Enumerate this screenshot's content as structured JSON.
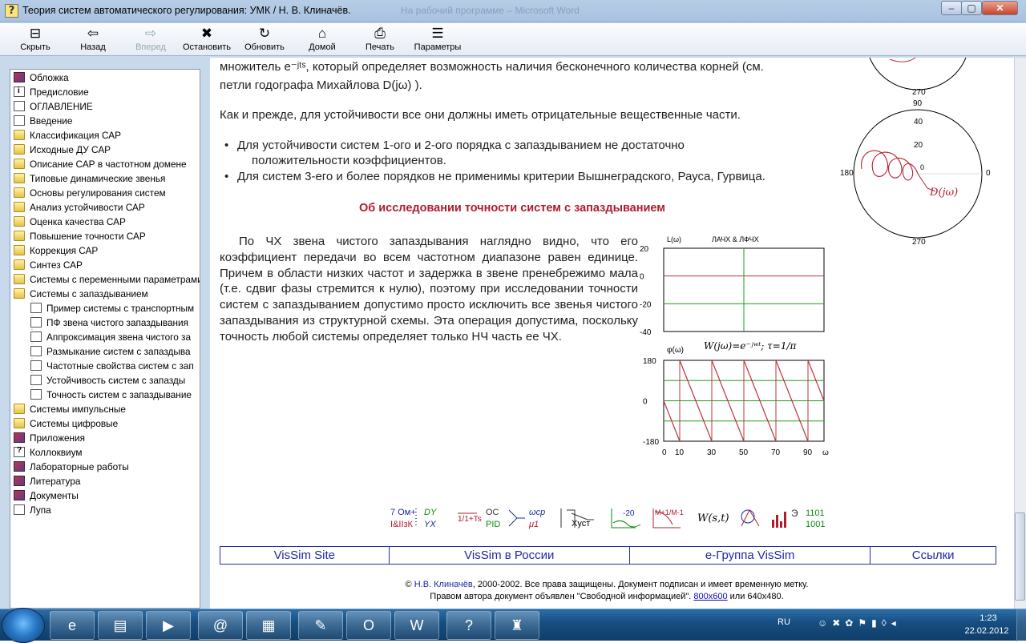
{
  "window": {
    "title": "Теория систем автоматического регулирования: УМК / Н. В. Клиначёв.",
    "background_title": "На рабочий программе – Microsoft Word",
    "controls": {
      "minimize": "–",
      "maximize": "▢",
      "close": "✕"
    }
  },
  "toolbar": [
    {
      "label": "Скрыть",
      "icon": "hide-pane-icon",
      "glyph": "⊟",
      "enabled": true
    },
    {
      "label": "Назад",
      "icon": "back-arrow-icon",
      "glyph": "⇦",
      "enabled": true
    },
    {
      "label": "Вперед",
      "icon": "forward-arrow-icon",
      "glyph": "⇨",
      "enabled": false
    },
    {
      "label": "Остановить",
      "icon": "stop-icon",
      "glyph": "✖",
      "enabled": true
    },
    {
      "label": "Обновить",
      "icon": "refresh-icon",
      "glyph": "↻",
      "enabled": true
    },
    {
      "label": "Домой",
      "icon": "home-icon",
      "glyph": "⌂",
      "enabled": true
    },
    {
      "label": "Печать",
      "icon": "print-icon",
      "glyph": "⎙",
      "enabled": true
    },
    {
      "label": "Параметры",
      "icon": "options-icon",
      "glyph": "☰",
      "enabled": true
    }
  ],
  "tree": [
    {
      "label": "Обложка",
      "icon": "book",
      "level": 0
    },
    {
      "label": "Предисловие",
      "icon": "page-i",
      "level": 0
    },
    {
      "label": "ОГЛАВЛЕНИЕ",
      "icon": "page",
      "level": 0
    },
    {
      "label": "Введение",
      "icon": "page",
      "level": 0
    },
    {
      "label": "Классификация САР",
      "icon": "folder",
      "level": 0
    },
    {
      "label": "Исходные ДУ САР",
      "icon": "folder",
      "level": 0
    },
    {
      "label": "Описание САР в частотном домене",
      "icon": "folder",
      "level": 0
    },
    {
      "label": "Типовые динамические звенья",
      "icon": "folder",
      "level": 0
    },
    {
      "label": "Основы регулирования систем",
      "icon": "folder",
      "level": 0
    },
    {
      "label": "Анализ устойчивости САР",
      "icon": "folder",
      "level": 0
    },
    {
      "label": "Оценка качества САР",
      "icon": "folder",
      "level": 0
    },
    {
      "label": "Повышение точности САР",
      "icon": "folder",
      "level": 0
    },
    {
      "label": "Коррекция САР",
      "icon": "folder",
      "level": 0
    },
    {
      "label": "Синтез САР",
      "icon": "folder",
      "level": 0
    },
    {
      "label": "Системы с переменными параметрами",
      "icon": "folder",
      "level": 0
    },
    {
      "label": "Системы с запаздыванием",
      "icon": "folder-open",
      "level": 0
    },
    {
      "label": "Пример системы с транспортным",
      "icon": "page",
      "level": 1
    },
    {
      "label": "ПФ звена чистого запаздывания",
      "icon": "page",
      "level": 1
    },
    {
      "label": "Аппроксимация звена чистого за",
      "icon": "page",
      "level": 1
    },
    {
      "label": "Размыкание систем с запаздыва",
      "icon": "page",
      "level": 1
    },
    {
      "label": "Частотные свойства систем с зап",
      "icon": "page",
      "level": 1
    },
    {
      "label": "Устойчивость систем с запазды",
      "icon": "page",
      "level": 1
    },
    {
      "label": "Точность систем с запаздывание",
      "icon": "page",
      "level": 1
    },
    {
      "label": "Системы импульсные",
      "icon": "folder",
      "level": 0
    },
    {
      "label": "Системы цифровые",
      "icon": "folder",
      "level": 0
    },
    {
      "label": "Приложения",
      "icon": "book",
      "level": 0
    },
    {
      "label": "Коллоквиум",
      "icon": "page-q",
      "level": 0
    },
    {
      "label": "Лабораторные работы",
      "icon": "book",
      "level": 0
    },
    {
      "label": "Литература",
      "icon": "book",
      "level": 0
    },
    {
      "label": "Документы",
      "icon": "book",
      "level": 0
    },
    {
      "label": "Лупа",
      "icon": "page",
      "level": 0
    }
  ],
  "content": {
    "intro_line1": "множитель e⁻ʲᵗˢ, который определяет возможность наличия бесконечного количества корней (см.",
    "intro_line2": "петли годографа Михайлова D(jω) ).",
    "stability": "Как и прежде, для устойчивости все они должны иметь отрицательные вещественные части.",
    "bullets": [
      "Для устойчивости систем 1-ого и 2-ого порядка с запаздыванием не достаточно",
      "положительности коэффициентов.",
      "Для систем 3-его и более порядков не применимы критерии Вышнеградского, Рауса, Гурвица."
    ],
    "heading": "Об исследовании точности систем с запаздыванием",
    "paragraph": "По ЧХ звена чистого запаздывания наглядно видно, что его коэффициент передачи во всем частотном диапазоне равен единице. Причем в области низких частот и задержка в звене пренебрежимо мала (т.е. сдвиг фазы стремится к нулю), поэтому при исследовании точности систем с запаздыванием допустимо просто исключить все звенья чистого запаздывания из структурной схемы. Эта операция допустима, поскольку точность любой системы определяет только НЧ часть ее ЧХ."
  },
  "chart_data": [
    {
      "type": "line",
      "title": "ЛАЧХ & ЛФЧХ",
      "ylabel": "L(ω)",
      "yticks": [
        "20",
        "0",
        "-20",
        "-40"
      ],
      "ylim": [
        -40,
        20
      ],
      "series": [
        {
          "values": [
            0,
            0
          ]
        }
      ]
    },
    {
      "type": "line",
      "title": "W(jω)=e⁻ʲʷᵗ;  τ=1/π",
      "ylabel": "φ(ω)",
      "xlabel": "ω",
      "yticks": [
        "180",
        "0",
        "-180"
      ],
      "xticks": [
        "0",
        "10",
        "30",
        "50",
        "70",
        "90",
        "ω"
      ],
      "ylim": [
        -180,
        180
      ],
      "xlim": [
        0,
        100
      ],
      "series": [
        {
          "x": [
            0,
            10,
            10,
            30,
            30,
            50,
            50,
            70,
            70,
            90,
            90,
            100
          ],
          "values": [
            0,
            -180,
            180,
            -180,
            180,
            -180,
            180,
            -180,
            180,
            -180,
            180,
            0
          ]
        }
      ]
    }
  ],
  "nyquist": {
    "top_label": "270",
    "labels": {
      "top": "90",
      "bottom": "270",
      "left": "180",
      "right": "0",
      "r40": "40",
      "r20": "20",
      "r0": "0"
    },
    "curve_label": "D(jω)"
  },
  "iconbar": {
    "items": [
      "7 Ом+",
      "I&IIзК",
      "DY",
      "YX",
      "1/1+Ts",
      "OC",
      "PID",
      "ωcp",
      "μ1",
      "Xуст",
      "-20",
      "M+1/M-1",
      "W(s,t)",
      "Э",
      "1101",
      "1001"
    ]
  },
  "links": [
    {
      "label": "VisSim Site",
      "w": 211
    },
    {
      "label": "VisSim в России",
      "w": 301
    },
    {
      "label": "e-Группа VisSim",
      "w": 301
    },
    {
      "label": "Ссылки",
      "w": 156
    }
  ],
  "footer": {
    "copyright_prefix": "©",
    "author": "Н.В. Клиначёв",
    "copyright_rest": ", 2000-2002. Все права защищены. Документ подписан и имеет временную метку.",
    "line2_prefix": "Правом автора документ объявлен \"Свободной информацией\".",
    "link_800": "800х600",
    "line2_mid": " или 640х480."
  },
  "taskbar": {
    "apps": [
      {
        "name": "ie",
        "glyph": "e"
      },
      {
        "name": "explorer",
        "glyph": "▤"
      },
      {
        "name": "media-player",
        "glyph": "▶"
      },
      {
        "name": "mail-agent",
        "glyph": "@"
      },
      {
        "name": "winrar",
        "glyph": "▦"
      },
      {
        "name": "editor",
        "glyph": "✎"
      },
      {
        "name": "opera",
        "glyph": "O"
      },
      {
        "name": "word",
        "glyph": "W"
      },
      {
        "name": "help",
        "glyph": "?"
      },
      {
        "name": "other",
        "glyph": "♜"
      }
    ],
    "lang": "RU",
    "time": "1:23",
    "date": "22.02.2012"
  }
}
